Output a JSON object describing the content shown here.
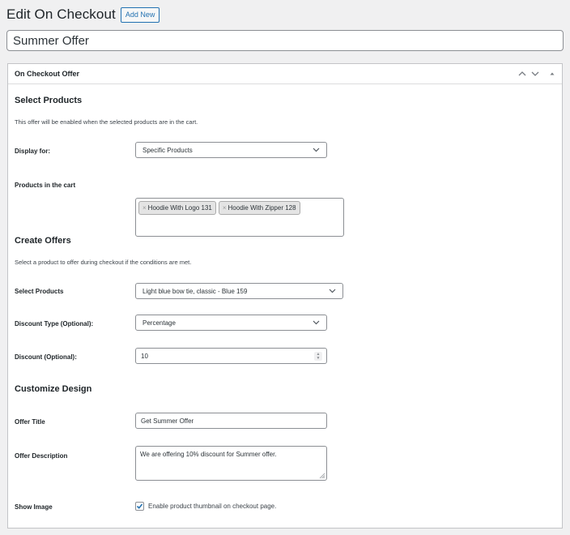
{
  "header": {
    "title": "Edit On Checkout",
    "add_new_label": "Add New"
  },
  "post_title": {
    "value": "Summer Offer"
  },
  "panel": {
    "title": "On Checkout Offer",
    "controls": [
      {
        "icon": "chevron-up-icon",
        "label": "Move up"
      },
      {
        "icon": "chevron-down-icon",
        "label": "Move down"
      },
      {
        "icon": "triangle-up-icon",
        "label": "Toggle panel"
      }
    ]
  },
  "select_products_section": {
    "heading": "Select Products",
    "description": "This offer will be enabled when the selected products are in the cart.",
    "display_for": {
      "label": "Display for:",
      "value": "Specific Products"
    },
    "products_in_cart": {
      "label": "Products in the cart",
      "chips": [
        {
          "remove": "×",
          "label": "Hoodie With Logo 131"
        },
        {
          "remove": "×",
          "label": "Hoodie With Zipper 128"
        }
      ]
    }
  },
  "create_offers_section": {
    "heading": "Create Offers",
    "description": "Select a product to offer during checkout if the conditions are met.",
    "select_products": {
      "label": "Select Products",
      "value": "Light blue bow tie, classic - Blue 159"
    },
    "discount_type": {
      "label": "Discount Type (Optional):",
      "value": "Percentage"
    },
    "discount": {
      "label": "Discount (Optional):",
      "value": "10"
    }
  },
  "customize_design_section": {
    "heading": "Customize Design",
    "offer_title": {
      "label": "Offer Title",
      "value": "Get Summer Offer"
    },
    "offer_description": {
      "label": "Offer Description",
      "value": "We are offering 10% discount for Summer offer."
    },
    "show_image": {
      "label": "Show Image",
      "checkbox_label": "Enable product thumbnail on checkout page.",
      "checked": true
    }
  },
  "colors": {
    "accent": "#2271b1",
    "background": "#f0f0f1",
    "panel": "#ffffff",
    "border": "#c3c4c7"
  }
}
